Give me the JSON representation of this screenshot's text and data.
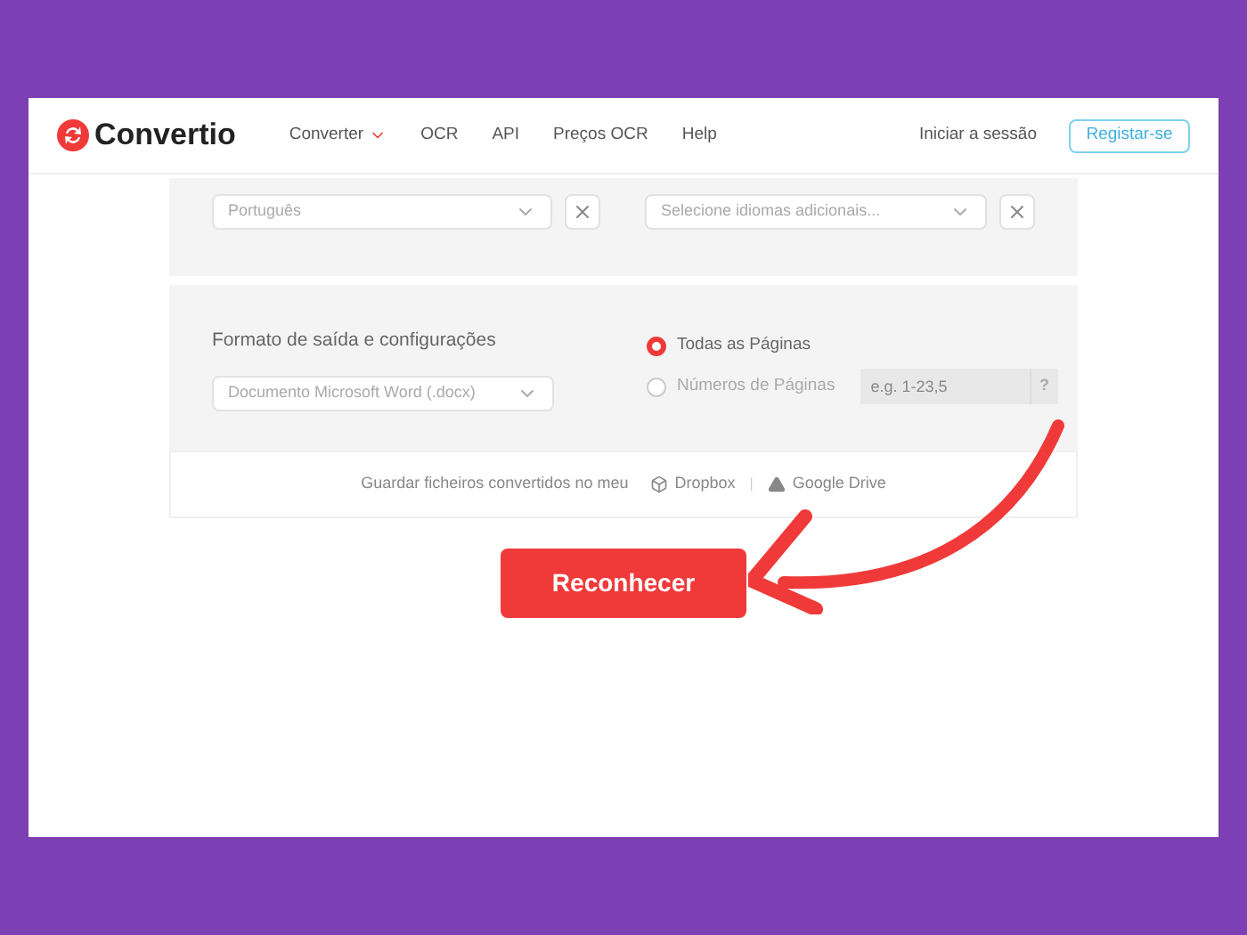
{
  "header": {
    "logo": "Convertio",
    "nav": [
      {
        "label": "Converter",
        "dropdown": true
      },
      {
        "label": "OCR",
        "dropdown": false
      },
      {
        "label": "API",
        "dropdown": false
      },
      {
        "label": "Preços OCR",
        "dropdown": false
      },
      {
        "label": "Help",
        "dropdown": false
      }
    ],
    "login": "Iniciar a sessão",
    "register": "Registar-se"
  },
  "language": {
    "primary": {
      "value": "Português"
    },
    "additional": {
      "placeholder": "Selecione idiomas adicionais..."
    }
  },
  "output": {
    "title": "Formato de saída e configurações",
    "format": "Documento Microsoft Word (.docx)",
    "pages": [
      {
        "label": "Todas as Páginas",
        "selected": true
      },
      {
        "label": "Números de Páginas",
        "selected": false
      }
    ],
    "range_placeholder": "e.g. 1-23,5",
    "help": "?"
  },
  "save": {
    "text": "Guardar ficheiros convertidos no meu",
    "services": [
      {
        "label": "Dropbox",
        "kind": "dropbox"
      },
      {
        "label": "Google Drive",
        "kind": "drive"
      }
    ],
    "separator": "|"
  },
  "action": "Reconhecer"
}
